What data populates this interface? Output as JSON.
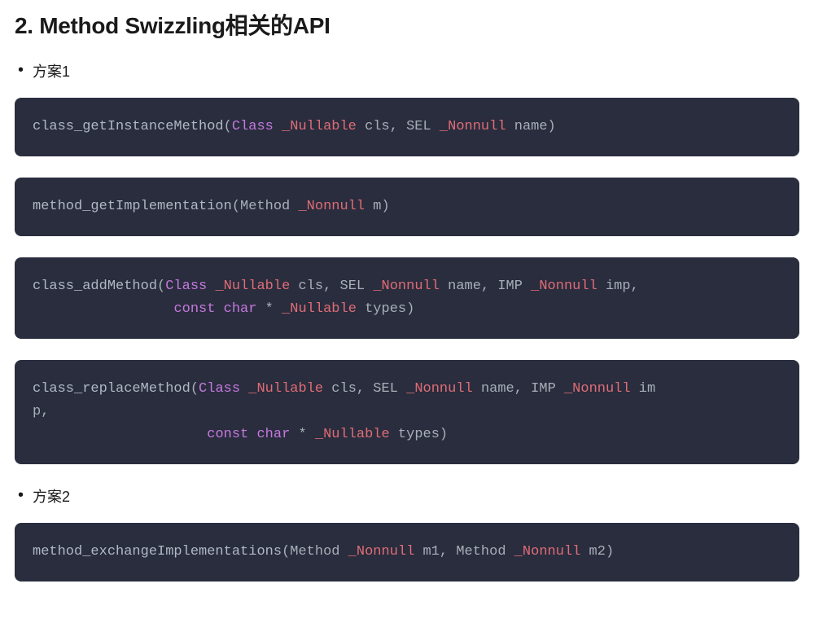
{
  "heading": "2. Method Swizzling相关的API",
  "sections": [
    {
      "bullet": "方案1",
      "code_blocks": [
        {
          "lines": [
            {
              "segments": [
                {
                  "cls": "fn",
                  "text": "class_getInstanceMethod"
                },
                {
                  "cls": "punct",
                  "text": "("
                },
                {
                  "cls": "type",
                  "text": "Class"
                },
                {
                  "cls": "punct",
                  "text": " "
                },
                {
                  "cls": "attr",
                  "text": "_Nullable"
                },
                {
                  "cls": "punct",
                  "text": " cls, SEL "
                },
                {
                  "cls": "attr",
                  "text": "_Nonnull"
                },
                {
                  "cls": "punct",
                  "text": " name)"
                }
              ]
            }
          ]
        },
        {
          "lines": [
            {
              "segments": [
                {
                  "cls": "fn",
                  "text": "method_getImplementation"
                },
                {
                  "cls": "punct",
                  "text": "(Method "
                },
                {
                  "cls": "attr",
                  "text": "_Nonnull"
                },
                {
                  "cls": "punct",
                  "text": " m)"
                }
              ]
            }
          ]
        },
        {
          "lines": [
            {
              "segments": [
                {
                  "cls": "fn",
                  "text": "class_addMethod"
                },
                {
                  "cls": "punct",
                  "text": "("
                },
                {
                  "cls": "type",
                  "text": "Class"
                },
                {
                  "cls": "punct",
                  "text": " "
                },
                {
                  "cls": "attr",
                  "text": "_Nullable"
                },
                {
                  "cls": "punct",
                  "text": " cls, SEL "
                },
                {
                  "cls": "attr",
                  "text": "_Nonnull"
                },
                {
                  "cls": "punct",
                  "text": " name, IMP "
                },
                {
                  "cls": "attr",
                  "text": "_Nonnull"
                },
                {
                  "cls": "punct",
                  "text": " imp,"
                }
              ]
            },
            {
              "segments": [
                {
                  "cls": "punct",
                  "text": "                 "
                },
                {
                  "cls": "keyword",
                  "text": "const"
                },
                {
                  "cls": "punct",
                  "text": " "
                },
                {
                  "cls": "keyword",
                  "text": "char"
                },
                {
                  "cls": "punct",
                  "text": " * "
                },
                {
                  "cls": "attr",
                  "text": "_Nullable"
                },
                {
                  "cls": "punct",
                  "text": " types)"
                }
              ]
            }
          ]
        },
        {
          "lines": [
            {
              "segments": [
                {
                  "cls": "fn",
                  "text": "class_replaceMethod"
                },
                {
                  "cls": "punct",
                  "text": "("
                },
                {
                  "cls": "type",
                  "text": "Class"
                },
                {
                  "cls": "punct",
                  "text": " "
                },
                {
                  "cls": "attr",
                  "text": "_Nullable"
                },
                {
                  "cls": "punct",
                  "text": " cls, SEL "
                },
                {
                  "cls": "attr",
                  "text": "_Nonnull"
                },
                {
                  "cls": "punct",
                  "text": " name, IMP "
                },
                {
                  "cls": "attr",
                  "text": "_Nonnull"
                },
                {
                  "cls": "punct",
                  "text": " im"
                }
              ]
            },
            {
              "segments": [
                {
                  "cls": "punct",
                  "text": "p,"
                }
              ]
            },
            {
              "segments": [
                {
                  "cls": "punct",
                  "text": "                     "
                },
                {
                  "cls": "keyword",
                  "text": "const"
                },
                {
                  "cls": "punct",
                  "text": " "
                },
                {
                  "cls": "keyword",
                  "text": "char"
                },
                {
                  "cls": "punct",
                  "text": " * "
                },
                {
                  "cls": "attr",
                  "text": "_Nullable"
                },
                {
                  "cls": "punct",
                  "text": " types)"
                }
              ]
            }
          ]
        }
      ]
    },
    {
      "bullet": "方案2",
      "code_blocks": [
        {
          "lines": [
            {
              "segments": [
                {
                  "cls": "fn",
                  "text": "method_exchangeImplementations"
                },
                {
                  "cls": "punct",
                  "text": "(Method "
                },
                {
                  "cls": "attr",
                  "text": "_Nonnull"
                },
                {
                  "cls": "punct",
                  "text": " m1, Method "
                },
                {
                  "cls": "attr",
                  "text": "_Nonnull"
                },
                {
                  "cls": "punct",
                  "text": " m2)"
                }
              ]
            }
          ]
        }
      ]
    }
  ]
}
